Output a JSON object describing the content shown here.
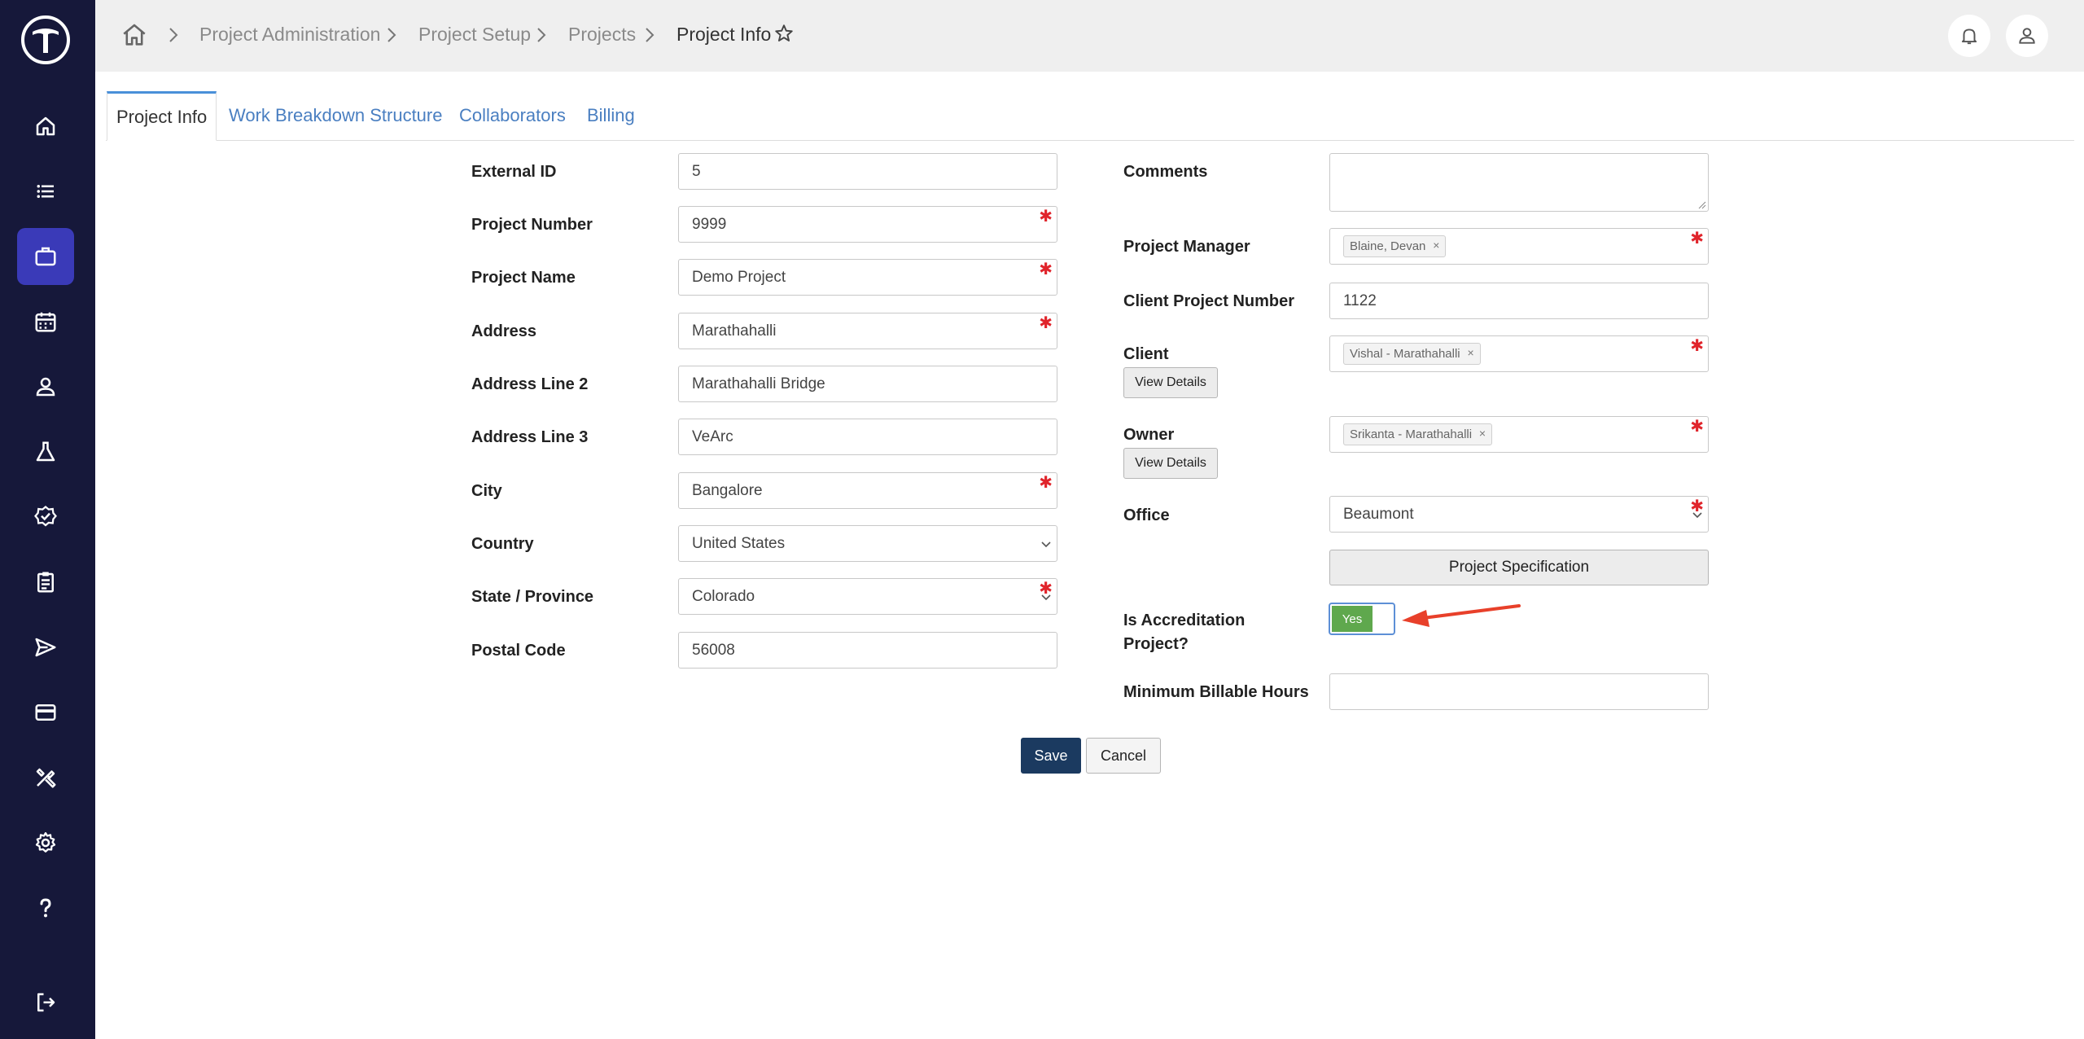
{
  "breadcrumb": {
    "items": [
      "Project Administration",
      "Project Setup",
      "Projects"
    ],
    "current": "Project Info"
  },
  "sidebar": {
    "items": [
      {
        "icon": "home-icon"
      },
      {
        "icon": "list-icon"
      },
      {
        "icon": "briefcase-icon",
        "active": true
      },
      {
        "icon": "calendar-icon"
      },
      {
        "icon": "user-icon"
      },
      {
        "icon": "flask-icon"
      },
      {
        "icon": "badge-check-icon"
      },
      {
        "icon": "clipboard-icon"
      },
      {
        "icon": "send-icon"
      },
      {
        "icon": "credit-card-icon"
      },
      {
        "icon": "tools-icon"
      },
      {
        "icon": "gear-icon"
      },
      {
        "icon": "help-icon"
      },
      {
        "icon": "logout-icon"
      }
    ]
  },
  "tabs": [
    "Project Info",
    "Work Breakdown Structure",
    "Collaborators",
    "Billing"
  ],
  "left_form": {
    "external_id": {
      "label": "External ID",
      "value": "5"
    },
    "project_number": {
      "label": "Project Number",
      "value": "9999"
    },
    "project_name": {
      "label": "Project Name",
      "value": "Demo Project"
    },
    "address": {
      "label": "Address",
      "value": "Marathahalli"
    },
    "address2": {
      "label": "Address Line 2",
      "value": "Marathahalli Bridge"
    },
    "address3": {
      "label": "Address Line 3",
      "value": "VeArc"
    },
    "city": {
      "label": "City",
      "value": "Bangalore"
    },
    "country": {
      "label": "Country",
      "value": "United States"
    },
    "state": {
      "label": "State / Province",
      "value": "Colorado"
    },
    "postal": {
      "label": "Postal Code",
      "value": "56008"
    }
  },
  "right_form": {
    "comments": {
      "label": "Comments",
      "value": ""
    },
    "project_manager": {
      "label": "Project Manager",
      "tag": "Blaine, Devan"
    },
    "client_project_number": {
      "label": "Client Project Number",
      "value": "1122"
    },
    "client": {
      "label": "Client",
      "tag": "Vishal - Marathahalli",
      "button": "View Details"
    },
    "owner": {
      "label": "Owner",
      "tag": "Srikanta - Marathahalli",
      "button": "View Details"
    },
    "office": {
      "label": "Office",
      "value": "Beaumont"
    },
    "project_specification": "Project Specification",
    "accreditation": {
      "label_line1": "Is Accreditation",
      "label_line2": "Project?",
      "toggle": "Yes"
    },
    "min_billable": {
      "label": "Minimum Billable Hours",
      "value": ""
    }
  },
  "actions": {
    "save": "Save",
    "cancel": "Cancel"
  },
  "colors": {
    "sidebar": "#16183a",
    "active_nav": "#3a3ab8",
    "required": "#e0242b",
    "toggle_on": "#5fa84d",
    "save": "#1b3a60",
    "arrow": "#e8402a"
  }
}
